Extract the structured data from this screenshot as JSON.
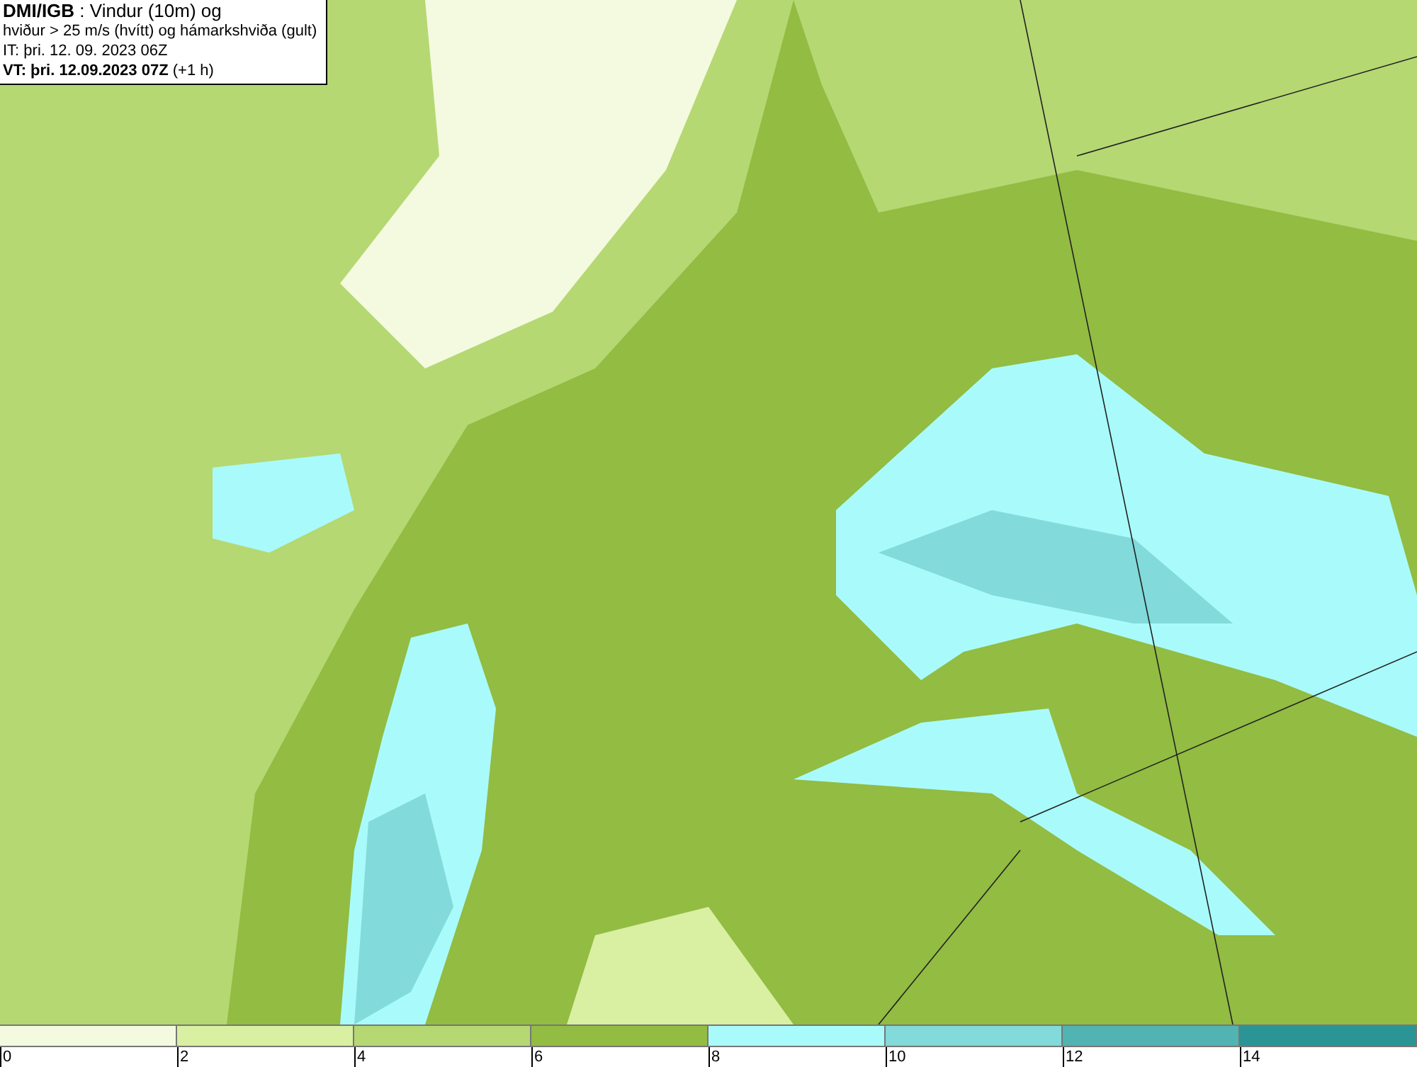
{
  "caption": {
    "lines": [
      "**DMI/IGB** : Vindur (10m) og",
      "hviður > 25 m/s (hvítt) og hámarkshviða (gult)",
      "IT: þri. 12. 09. 2023 06Z",
      "**VT: þri. 12.09.2023 07Z** (+1 h)"
    ]
  },
  "legend": {
    "bins": [
      {
        "label": "0",
        "color": "#f4fadf"
      },
      {
        "label": "2",
        "color": "#d9efa2"
      },
      {
        "label": "4",
        "color": "#b5d873"
      },
      {
        "label": "6",
        "color": "#92bc42"
      },
      {
        "label": "8",
        "color": "#a9fbfb"
      },
      {
        "label": "10",
        "color": "#82dada"
      },
      {
        "label": "12",
        "color": "#52b3b3"
      },
      {
        "label": "14",
        "color": "#2b9494"
      }
    ]
  }
}
